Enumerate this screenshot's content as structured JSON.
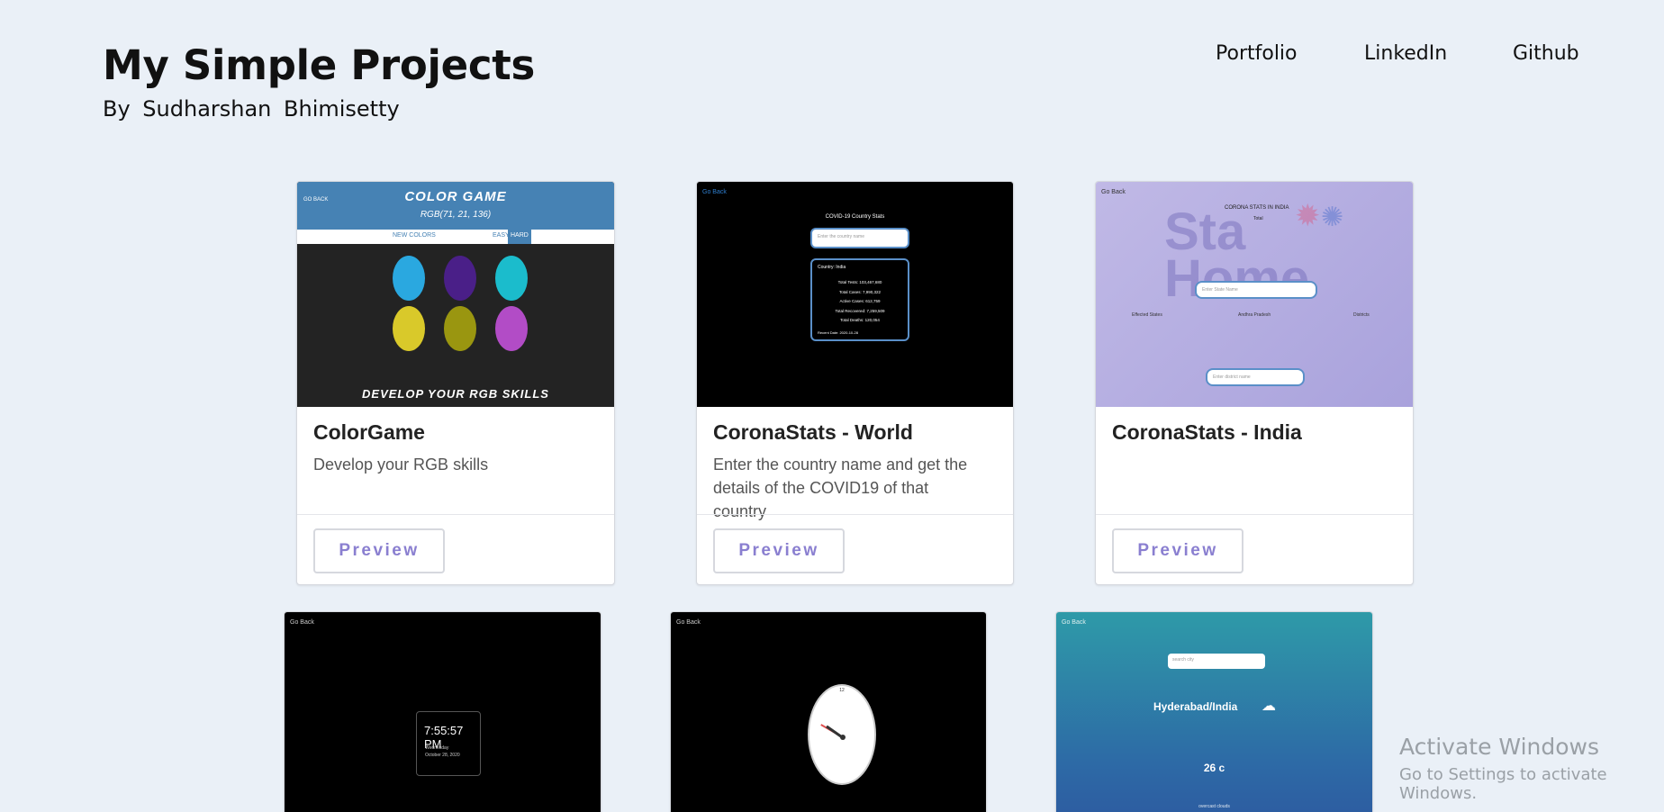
{
  "header": {
    "title": "My Simple Projects",
    "subtitle": "By Sudharshan Bhimisetty",
    "nav": [
      "Portfolio",
      "LinkedIn",
      "Github"
    ]
  },
  "cards": [
    {
      "title": "ColorGame",
      "description": "Develop your RGB skills",
      "button": "Preview"
    },
    {
      "title": "CoronaStats - World",
      "description": "Enter the country name and get the details of the COVID19 of that country",
      "button": "Preview"
    },
    {
      "title": "CoronaStats - India",
      "description": "",
      "button": "Preview"
    }
  ],
  "thumbnails": {
    "colorgame": {
      "back": "GO BACK",
      "title": "COLOR GAME",
      "rgb": "RGB(71, 21, 136)",
      "new_colors": "NEW COLORS",
      "easy": "EASY",
      "hard": "HARD",
      "tagline": "DEVELOP YOUR RGB SKILLS",
      "swatches": [
        "#2aa8e0",
        "#4a1f88",
        "#1bbccc",
        "#d9c92a",
        "#9a9610",
        "#b24cc6"
      ]
    },
    "world": {
      "back": "Go Back",
      "heading": "COVID-19  Country  Stats",
      "placeholder": "Enter the country name",
      "country": "Country: India",
      "lines": [
        "Total Tests: 103,467,680",
        "Total Cases: 7,990,322",
        "Active Cases: 612,759",
        "Total Recovered: 7,259,509",
        "Total Deaths: 120,054"
      ],
      "recent": "Recent Date: 2020-10-28"
    },
    "india": {
      "back": "Go Back",
      "heading": "CORONA STATS IN INDIA",
      "total": "Total",
      "state_placeholder": "Enter State Name",
      "district_placeholder": "Enter district name",
      "col_states": "Effected States",
      "col_state": "Andhra Pradesh",
      "col_districts": "Districts"
    },
    "digital_clock": {
      "back": "Go Back",
      "time": "7:55:57 PM",
      "day": "Wednesday",
      "date": "October 28, 2020"
    },
    "analog_clock": {
      "back": "Go Back",
      "twelve": "12"
    },
    "weather": {
      "back": "Go Back",
      "placeholder": "search city",
      "city": "Hyderabad/India",
      "temp": "26 c",
      "status": "overcast clouds"
    }
  },
  "watermark": {
    "line1": "Activate Windows",
    "line2": "Go to Settings to activate Windows."
  }
}
